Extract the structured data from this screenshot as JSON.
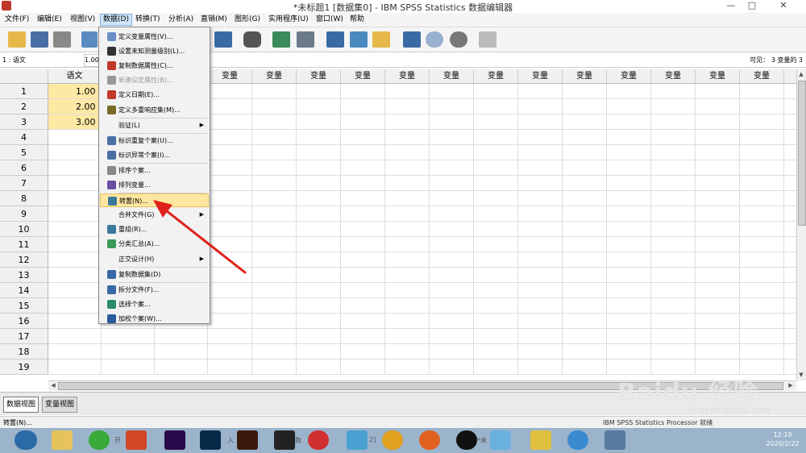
{
  "window": {
    "title": "*未标题1 [数据集0] - IBM SPSS Statistics 数据编辑器",
    "minimize": "—",
    "maximize": "□",
    "close": "✕"
  },
  "menubar": [
    "文件(F)",
    "编辑(E)",
    "视图(V)",
    "数据(D)",
    "转换(T)",
    "分析(A)",
    "直销(M)",
    "图形(G)",
    "实用程序(U)",
    "窗口(W)",
    "帮助"
  ],
  "toolbar_icons": [
    "open-folder-icon",
    "save-icon",
    "print-icon",
    "dialog-recall-icon",
    "undo-icon",
    "redo-icon",
    "goto-case-icon",
    "goto-variable-icon",
    "variables-icon",
    "find-icon",
    "insert-cases-icon",
    "insert-variable-icon",
    "split-file-icon",
    "weight-cases-icon",
    "select-cases-icon",
    "value-labels-icon",
    "use-sets-icon",
    "show-all-icon",
    "spell-check-icon"
  ],
  "refbar": {
    "cell_ref": "1 : 语文",
    "cell_value": "1.00",
    "visible": "可见： 3 变量的 3"
  },
  "grid": {
    "first_column": "语文",
    "var_header": "变量",
    "rows": [
      "1",
      "2",
      "3",
      "4",
      "5",
      "6",
      "7",
      "8",
      "9",
      "10",
      "11",
      "12",
      "13",
      "14",
      "15",
      "16",
      "17",
      "18",
      "19"
    ],
    "values": [
      "1.00",
      "2.00",
      "3.00"
    ]
  },
  "dropdown": [
    {
      "label": "定义变量属性(V)...",
      "icon": "define-properties-icon",
      "color": "#6a8fc7"
    },
    {
      "label": "设置未知测量级别(L)...",
      "icon": "measurement-level-icon",
      "color": "#333333"
    },
    {
      "label": "复制数据属性(C)...",
      "icon": "copy-properties-icon",
      "color": "#c0392b"
    },
    {
      "label": "新建设定属性(B)...",
      "icon": "custom-attribute-icon",
      "color": "#999999",
      "disabled": true
    },
    {
      "label": "定义日期(E)...",
      "icon": "define-dates-icon",
      "color": "#c0392b"
    },
    {
      "label": "定义多重响应集(M)...",
      "icon": "multiple-response-icon",
      "color": "#7a6a2a"
    },
    {
      "label": "验证(L)",
      "icon": "",
      "color": "",
      "submenu": true
    },
    {
      "label": "标识重复个案(U)...",
      "icon": "duplicate-cases-icon",
      "color": "#4a6fa5"
    },
    {
      "label": "标识异常个案(I)...",
      "icon": "unusual-cases-icon",
      "color": "#4a6fa5"
    },
    {
      "label": "排序个案...",
      "icon": "sort-cases-icon",
      "color": "#888888"
    },
    {
      "label": "排列变量...",
      "icon": "sort-variables-icon",
      "color": "#6a4fa5"
    },
    {
      "label": "转置(N)...",
      "icon": "transpose-icon",
      "color": "#3a7a9a",
      "highlighted": true
    },
    {
      "label": "合并文件(G)",
      "icon": "",
      "color": "",
      "submenu": true
    },
    {
      "label": "重组(R)...",
      "icon": "restructure-icon",
      "color": "#3a7a9a"
    },
    {
      "label": "分类汇总(A)...",
      "icon": "aggregate-icon",
      "color": "#3a9a5a"
    },
    {
      "label": "正交设计(H)",
      "icon": "",
      "color": "",
      "submenu": true
    },
    {
      "label": "复制数据集(D)",
      "icon": "copy-dataset-icon",
      "color": "#3a6aa5"
    },
    {
      "label": "拆分文件(F)...",
      "icon": "split-file-icon",
      "color": "#3a6aa5"
    },
    {
      "label": "选择个案...",
      "icon": "select-cases-icon",
      "color": "#2a8a6a"
    },
    {
      "label": "加权个案(W)...",
      "icon": "weight-cases-icon",
      "color": "#2a5a9a"
    }
  ],
  "tabs": {
    "data_view": "数据视图",
    "variable_view": "变量视图"
  },
  "status": {
    "left": "转置(N)...",
    "right": "IBM SPSS Statistics Processor 就绪"
  },
  "taskbar": {
    "labels": [
      "开",
      "入",
      "数",
      "2]",
      "*未"
    ],
    "clock_time": "12:19",
    "clock_date": "2020/2/22"
  },
  "watermark": {
    "text": "Baidu 经验",
    "url": "jingyan.baidu.com"
  },
  "colors": {
    "accent": "#7eb4ea",
    "highlight": "#fde6a0",
    "filled_cell": "#fde8a4",
    "arrow": "#e0201a"
  }
}
